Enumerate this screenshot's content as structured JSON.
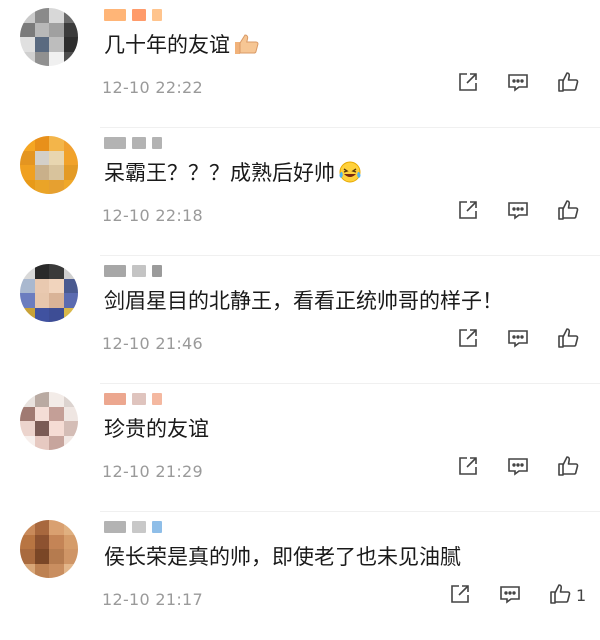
{
  "comments": [
    {
      "text": "几十年的友谊",
      "emoji": "thumbs-up-emoji",
      "time": "12-10 22:22",
      "like_count": "",
      "avatar_colors": [
        "#c9c9c9",
        "#8a8a8a",
        "#d8d8d8",
        "#6b6b6b",
        "#7b7b7b",
        "#b8b8b8",
        "#a0a0a0",
        "#3c3c3c",
        "#e0e0e0",
        "#5a6a80",
        "#bdbdbd",
        "#2e2e2e",
        "#d0d0d0",
        "#909090",
        "#f0f0f0",
        "#4d4d4d"
      ],
      "name_colors": [
        "#ff9c4a",
        "#ff7a3a",
        "#ffb067"
      ]
    },
    {
      "text": "呆霸王？？？成熟后好帅",
      "emoji": "laughing-crying-emoji",
      "time": "12-10 22:18",
      "like_count": "",
      "avatar_colors": [
        "#f5a623",
        "#e8901a",
        "#f3b54a",
        "#f0a030",
        "#e49520",
        "#d3cfc8",
        "#e8d6b0",
        "#f1a22a",
        "#f0a020",
        "#c9b08a",
        "#d8c39c",
        "#e39a25",
        "#e89a18",
        "#eaa428",
        "#e6a030",
        "#f0a829"
      ],
      "name_colors": [
        "#9a9a9a",
        "#9a9a9a",
        "#9a9a9a"
      ]
    },
    {
      "text": "剑眉星目的北静王，看看正统帅哥的样子！",
      "emoji": "",
      "time": "12-10 21:46",
      "like_count": "",
      "avatar_colors": [
        "#d9d9d9",
        "#2a2a2a",
        "#3a3a3a",
        "#cfcfcf",
        "#a9b8cf",
        "#e9c9b0",
        "#f1d4bd",
        "#4a5a90",
        "#6b7dbf",
        "#e7c7ad",
        "#d9b397",
        "#5b6bb0",
        "#c8a238",
        "#4052a0",
        "#3d4d95",
        "#d9b84a"
      ],
      "name_colors": [
        "#8a8a8a",
        "#b0b0b0",
        "#7a7a7a"
      ]
    },
    {
      "text": "珍贵的友谊",
      "emoji": "",
      "time": "12-10 21:29",
      "like_count": "",
      "avatar_colors": [
        "#e8e2de",
        "#b9aaa2",
        "#f3ece8",
        "#dcd3cf",
        "#a07a72",
        "#f4ddd6",
        "#c49f97",
        "#efe6e2",
        "#ecd4cd",
        "#7a5b55",
        "#f5dcd4",
        "#d4bdb6",
        "#f7efec",
        "#e6c9c1",
        "#c7a59d",
        "#f2e8e4"
      ],
      "name_colors": [
        "#e58a6a",
        "#d4b0a8",
        "#f0a080"
      ]
    },
    {
      "text": "侯长荣是真的帅，即使老了也未见油腻",
      "emoji": "",
      "time": "12-10 21:17",
      "like_count": "1",
      "avatar_colors": [
        "#c98a5a",
        "#a8683e",
        "#d9a070",
        "#e0b080",
        "#b87542",
        "#8d5230",
        "#c48456",
        "#d59c6a",
        "#a96a3e",
        "#7a4626",
        "#b57b4f",
        "#cf9566",
        "#d8a677",
        "#bd8152",
        "#c98e60",
        "#e3b68a"
      ],
      "name_colors": [
        "#9a9a9a",
        "#b5b5b5",
        "#6aa8e0"
      ]
    }
  ]
}
